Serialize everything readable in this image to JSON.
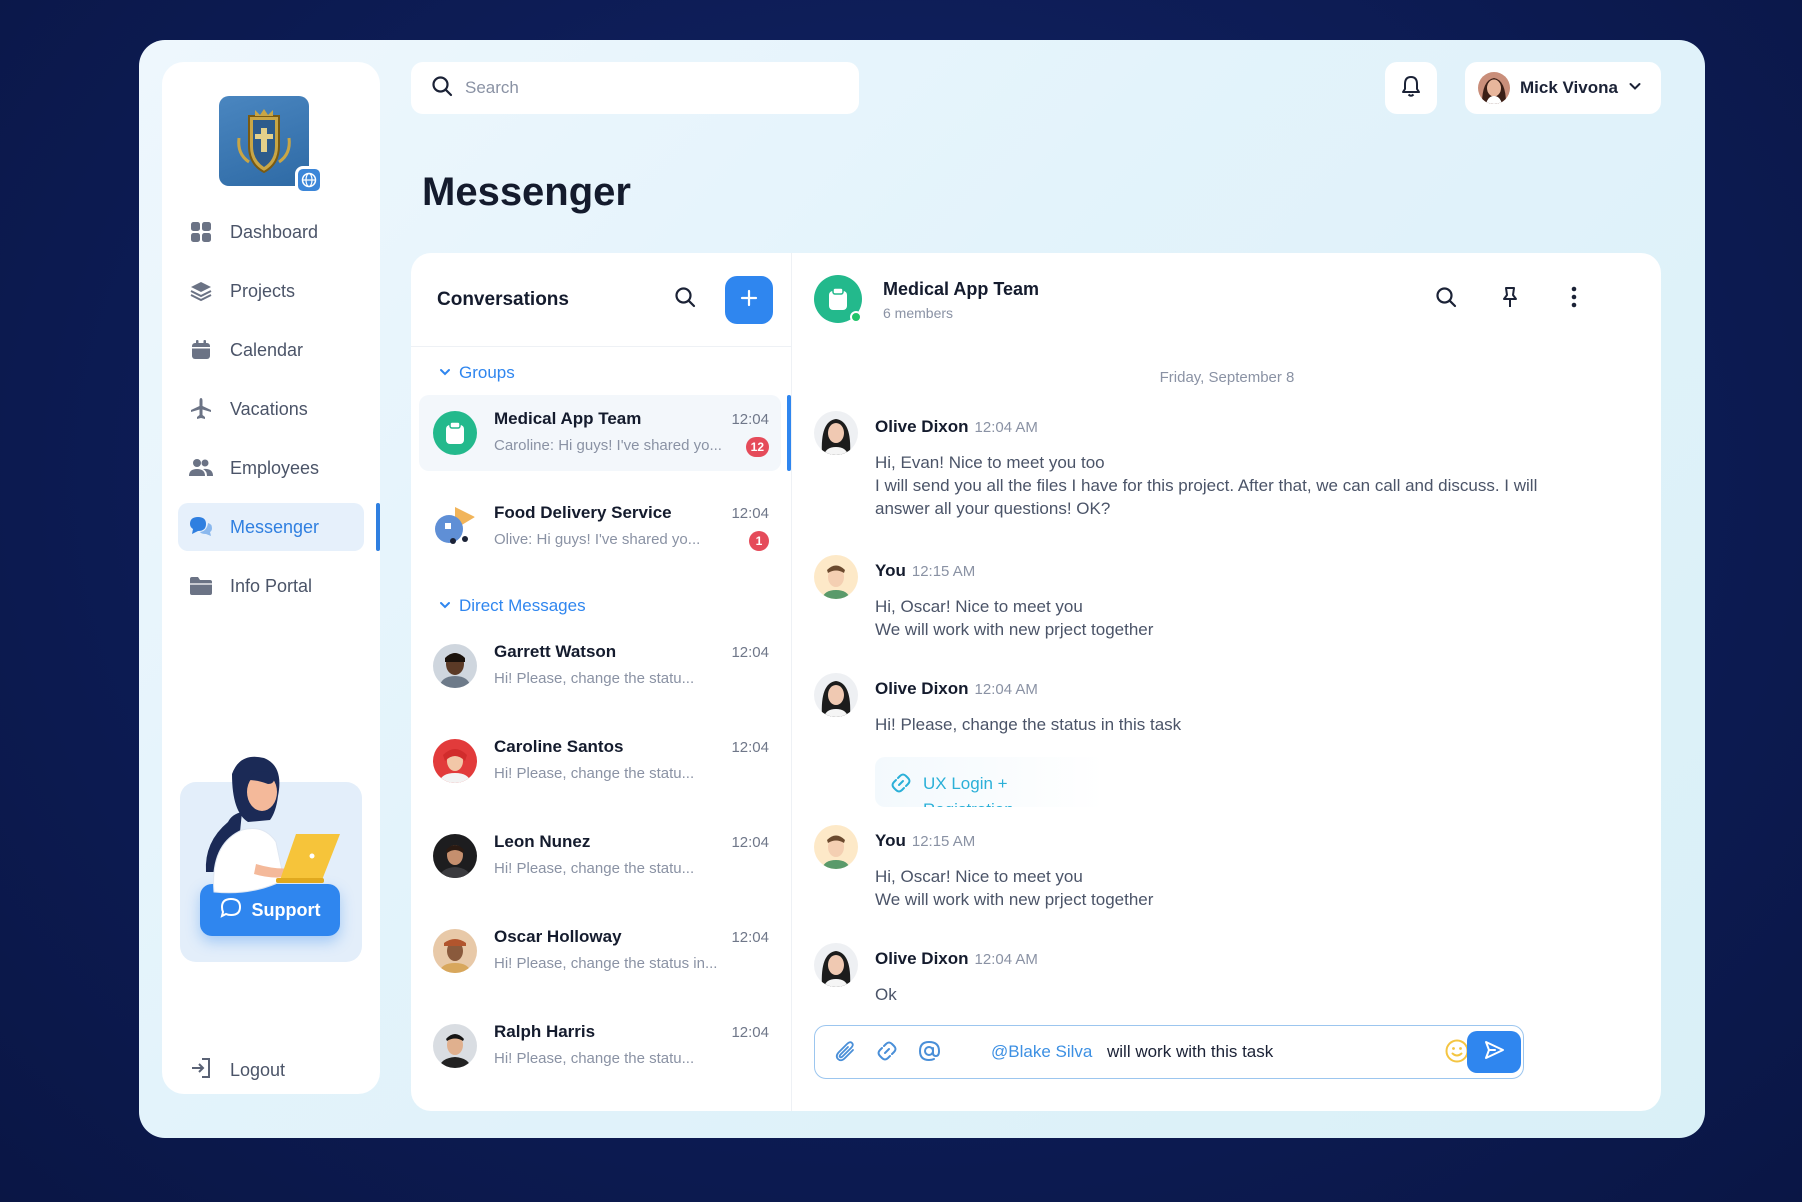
{
  "colors": {
    "accent": "#2f86ef",
    "badge": "#e54b5a",
    "online": "#21c46a",
    "group_green": "#23b98c"
  },
  "sidebar": {
    "items": [
      {
        "label": "Dashboard",
        "icon": "dashboard-icon"
      },
      {
        "label": "Projects",
        "icon": "layers-icon"
      },
      {
        "label": "Calendar",
        "icon": "calendar-icon"
      },
      {
        "label": "Vacations",
        "icon": "airplane-icon"
      },
      {
        "label": "Employees",
        "icon": "users-icon"
      },
      {
        "label": "Messenger",
        "icon": "chat-icon",
        "active": true
      },
      {
        "label": "Info Portal",
        "icon": "folder-icon"
      }
    ],
    "support_label": "Support",
    "logout_label": "Logout"
  },
  "header": {
    "search_placeholder": "Search",
    "user_name": "Mick Vivona"
  },
  "page_title": "Messenger",
  "conversations": {
    "title": "Conversations",
    "groups_label": "Groups",
    "direct_label": "Direct Messages",
    "groups": [
      {
        "name": "Medical App Team",
        "time": "12:04",
        "preview": "Caroline: Hi guys! I've shared yo...",
        "unread": "12",
        "active": true
      },
      {
        "name": "Food Delivery Service",
        "time": "12:04",
        "preview": "Olive: Hi guys! I've shared yo...",
        "unread": "1"
      }
    ],
    "direct": [
      {
        "name": "Garrett Watson",
        "time": "12:04",
        "preview": "Hi! Please, change the statu..."
      },
      {
        "name": "Caroline Santos",
        "time": "12:04",
        "preview": "Hi! Please, change the statu..."
      },
      {
        "name": "Leon Nunez",
        "time": "12:04",
        "preview": "Hi! Please, change the statu..."
      },
      {
        "name": "Oscar Holloway",
        "time": "12:04",
        "preview": "Hi! Please, change the status in..."
      },
      {
        "name": "Ralph Harris",
        "time": "12:04",
        "preview": "Hi! Please, change the statu..."
      }
    ]
  },
  "chat": {
    "name": "Medical App Team",
    "members": "6 members",
    "date_separator": "Friday, September 8",
    "messages": [
      {
        "author": "Olive Dixon",
        "time": "12:04 AM",
        "lines": [
          "Hi, Evan! Nice to meet you too",
          "I will send you all the files I have for this project. After that, we can call and discuss. I will answer all your questions! OK?"
        ]
      },
      {
        "author": "You",
        "time": "12:15 AM",
        "lines": [
          "Hi, Oscar! Nice to meet you",
          "We will work with new prject together"
        ]
      },
      {
        "author": "Olive Dixon",
        "time": "12:04 AM",
        "lines": [
          "Hi! Please, change the status in this task"
        ],
        "link": "UX Login + Registration"
      },
      {
        "author": "You",
        "time": "12:15 AM",
        "lines": [
          "Hi, Oscar! Nice to meet you",
          "We will work with new prject together"
        ]
      },
      {
        "author": "Olive Dixon",
        "time": "12:04 AM",
        "lines": [
          "Ok"
        ]
      }
    ],
    "composer": {
      "mention": "@Blake Silva",
      "value": "will work with this task"
    }
  }
}
